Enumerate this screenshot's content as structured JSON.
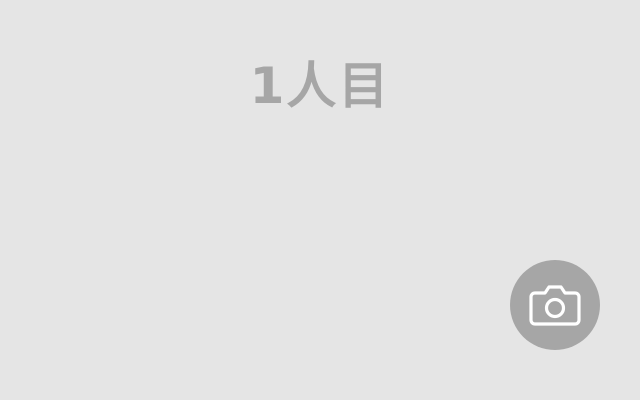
{
  "screen": {
    "person_label": "1人目",
    "background_color": "#e5e5e5",
    "text_color": "#a6a6a6"
  },
  "camera_button": {
    "icon": "camera-icon",
    "button_color": "#a6a6a6",
    "icon_color": "#ffffff"
  }
}
